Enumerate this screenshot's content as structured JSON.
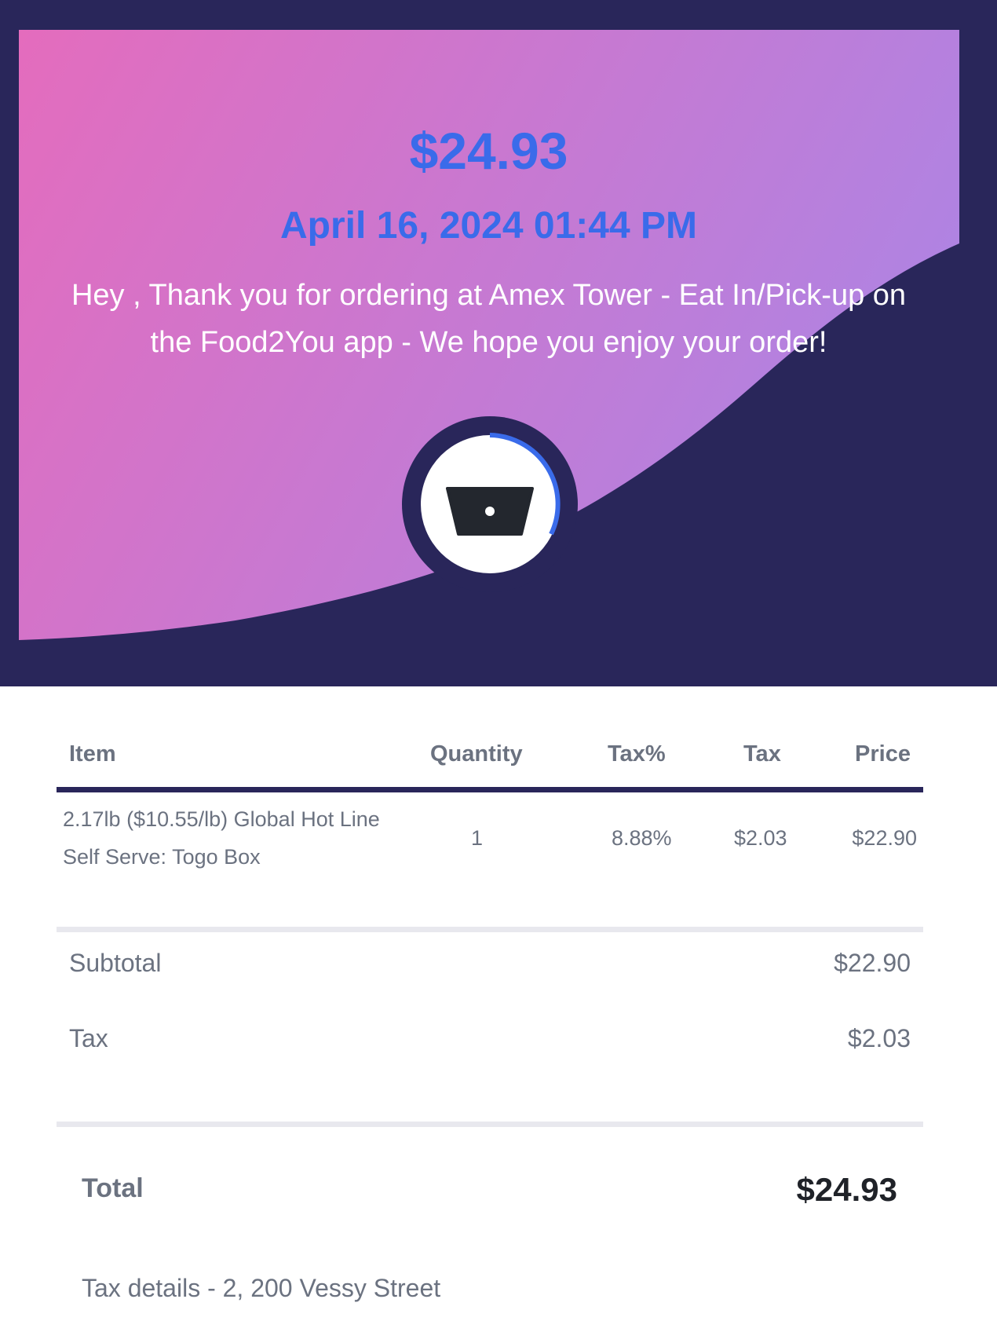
{
  "receipt": {
    "amount": "$24.93",
    "datetime": "April 16, 2024 01:44 PM",
    "message": "Hey , Thank you for ordering at Amex Tower - Eat In/Pick-up on the Food2You app - We hope you enjoy your order!"
  },
  "colors": {
    "background": "#29265a",
    "gradient_start": "#e46cbd",
    "gradient_end": "#b083e2",
    "accent": "#3a6bea"
  },
  "icons": {
    "badge": "togo-box-icon"
  },
  "table": {
    "headers": {
      "item": "Item",
      "quantity": "Quantity",
      "tax_percent": "Tax%",
      "tax": "Tax",
      "price": "Price"
    },
    "rows": [
      {
        "item_line1": "2.17lb ($10.55/lb) Global Hot Line",
        "item_line2": "Self Serve: Togo Box",
        "quantity": "1",
        "tax_percent": "8.88%",
        "tax": "$2.03",
        "price": "$22.90"
      }
    ]
  },
  "summary": {
    "subtotal_label": "Subtotal",
    "subtotal_value": "$22.90",
    "tax_label": "Tax",
    "tax_value": "$2.03",
    "total_label": "Total",
    "total_value": "$24.93",
    "tax_details": "Tax details - 2, 200 Vessy Street"
  }
}
